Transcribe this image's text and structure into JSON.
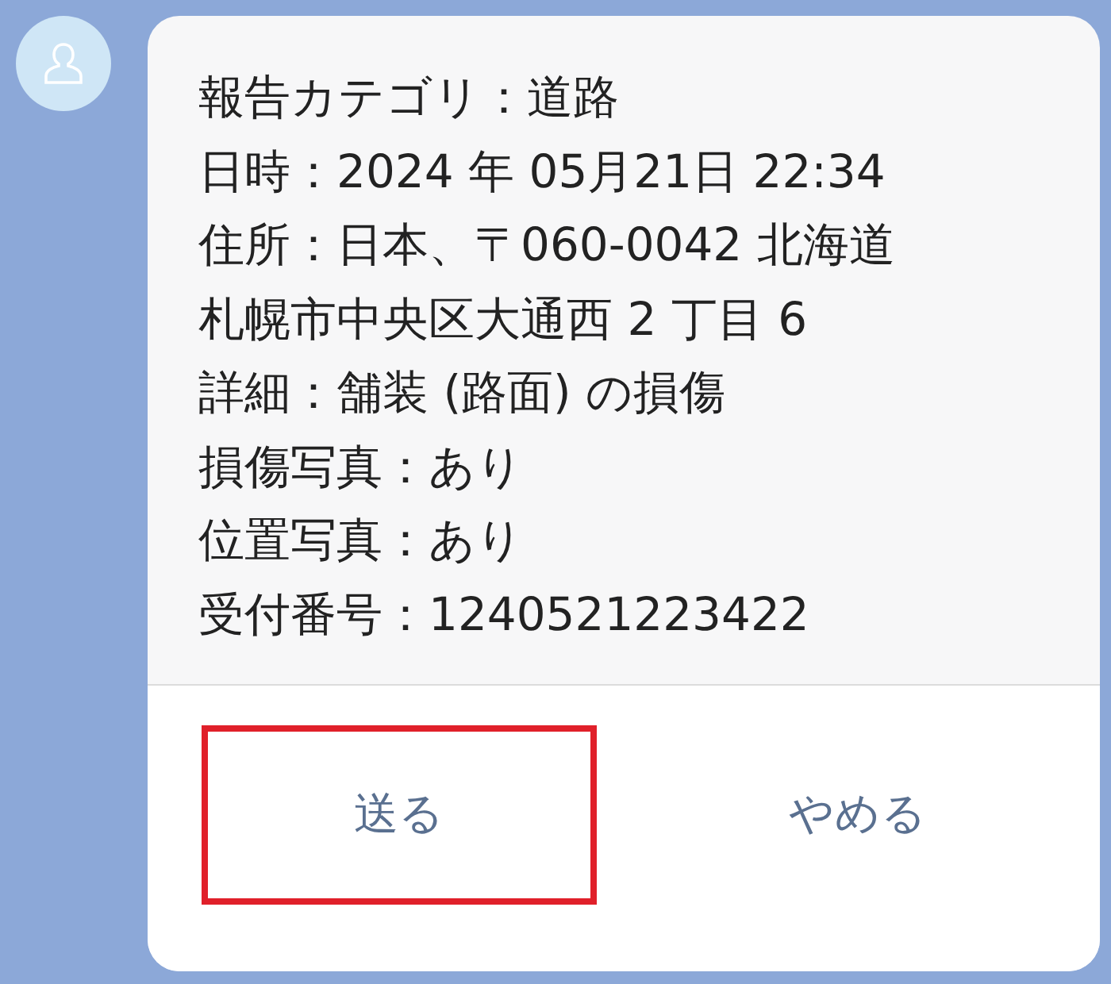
{
  "message": {
    "lines": [
      "報告カテゴリ：道路",
      "日時：2024 年 05月21日 22:34",
      "住所：日本、〒060-0042 北海道",
      "札幌市中央区大通西 2 丁目 6",
      "詳細：舗装 (路面) の損傷",
      "損傷写真：あり",
      "位置写真：あり",
      "受付番号：1240521223422"
    ]
  },
  "buttons": [
    {
      "label": "送る",
      "highlighted": true
    },
    {
      "label": "やめる",
      "highlighted": false
    }
  ]
}
